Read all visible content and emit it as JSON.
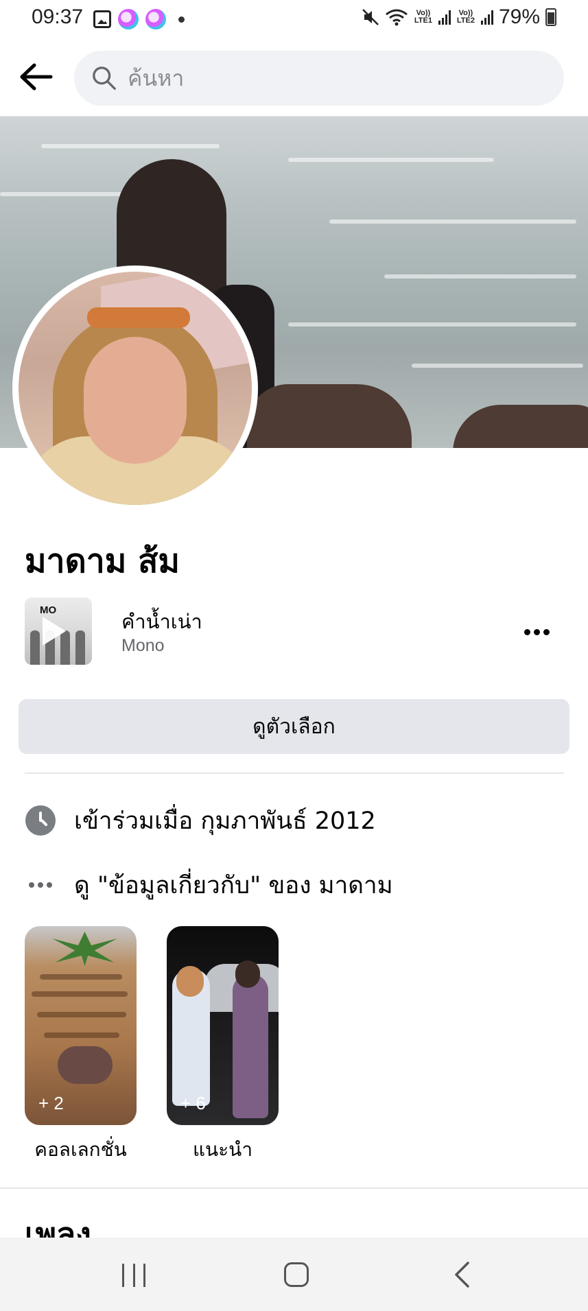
{
  "status_bar": {
    "time": "09:37",
    "battery": "79%",
    "net1": "Vo)) LTE1",
    "net2": "Vo)) LTE2",
    "icons": [
      "gallery-icon",
      "app-notification-icon",
      "app-notification-icon",
      "dot-icon",
      "mute-icon",
      "wifi-icon",
      "signal-icon",
      "signal-icon",
      "battery-icon"
    ]
  },
  "header": {
    "back_icon": "arrow-left-icon",
    "search_placeholder": "ค้นหา"
  },
  "profile": {
    "name": "มาดาม ส้ม"
  },
  "music": {
    "album_text": "MO",
    "title": "คำน้ำเน่า",
    "artist": "Mono"
  },
  "actions": {
    "options_label": "ดูตัวเลือก"
  },
  "info": {
    "joined": "เข้าร่วมเมื่อ กุมภาพันธ์ 2012",
    "about": "ดู \"ข้อมูลเกี่ยวกับ\" ของ มาดาม"
  },
  "highlights": [
    {
      "count": "+ 2",
      "label": "คอลเลกชั่น"
    },
    {
      "count": "+ 6",
      "label": "แนะนำ"
    }
  ],
  "next_section": {
    "title": "เพลง"
  },
  "colors": {
    "text_primary": "#050505",
    "text_secondary": "#65676b",
    "button_bg": "#e4e6eb",
    "search_bg": "#f0f2f5"
  }
}
